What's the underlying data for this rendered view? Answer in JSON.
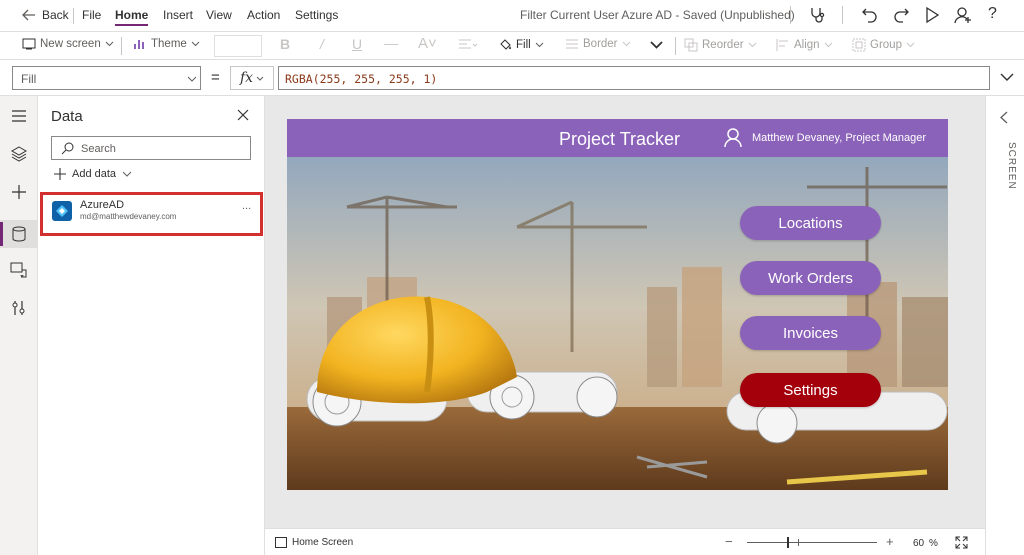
{
  "menu": {
    "back": "Back",
    "items": [
      "File",
      "Home",
      "Insert",
      "View",
      "Action",
      "Settings"
    ],
    "active": "Home",
    "doc_title": "Filter Current User Azure AD - Saved (Unpublished)"
  },
  "ribbon": {
    "new_screen": "New screen",
    "theme": "Theme",
    "fill": "Fill",
    "border": "Border",
    "reorder": "Reorder",
    "align": "Align",
    "group": "Group"
  },
  "formula": {
    "property": "Fill",
    "equals": "=",
    "fx": "fx",
    "value": "RGBA(255, 255, 255, 1)"
  },
  "data_pane": {
    "title": "Data",
    "search_placeholder": "Search",
    "add_data": "Add data",
    "source_name": "AzureAD",
    "source_account": "md@matthewdevaney.com",
    "more": "..."
  },
  "app_screen": {
    "header_title": "Project Tracker",
    "user_label": "Matthew Devaney, Project Manager",
    "buttons": [
      "Locations",
      "Work Orders",
      "Invoices",
      "Settings"
    ],
    "settings_color": "#a4000c",
    "button_color": "#8b62b9"
  },
  "rightbar": {
    "label": "SCREEN"
  },
  "status": {
    "screen_name": "Home Screen",
    "zoom": "60",
    "zoom_unit": "%",
    "zoom_level": 0.6
  },
  "colors": {
    "accent_purple": "#742774",
    "highlight_red": "#d32f2f"
  }
}
